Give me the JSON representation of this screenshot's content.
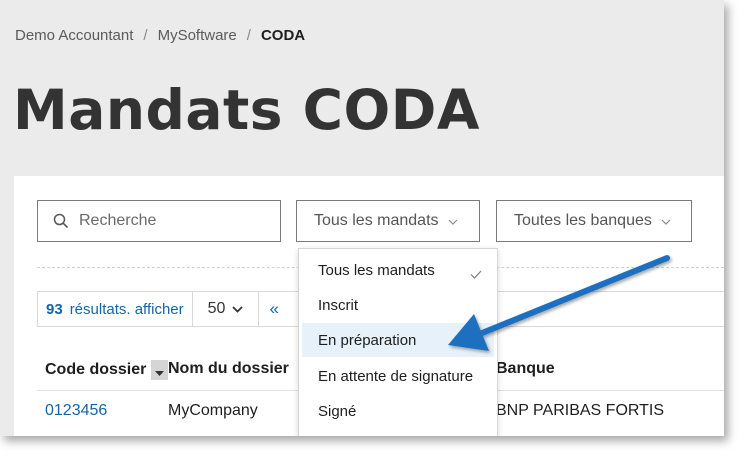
{
  "breadcrumb": {
    "items": [
      "Demo Accountant",
      "MySoftware"
    ],
    "current": "CODA",
    "separator": "/"
  },
  "page": {
    "title": "Mandats CODA"
  },
  "search": {
    "placeholder": "Recherche",
    "icon": "search-icon"
  },
  "filters": {
    "mandates": {
      "label": "Tous les mandats",
      "icon": "chevron-down-icon"
    },
    "banks": {
      "label": "Toutes les banques",
      "icon": "chevron-down-icon"
    }
  },
  "pager": {
    "count": "93",
    "results_text": "résultats. afficher",
    "page_size": "50",
    "first_glyph": "«"
  },
  "table": {
    "columns": {
      "code": "Code dossier",
      "name": "Nom du dossier",
      "bank": "Banque"
    },
    "rows": [
      {
        "code": "0123456",
        "name": "MyCompany",
        "bank": "BNP PARIBAS FORTIS"
      }
    ]
  },
  "dropdown": {
    "options": [
      {
        "label": "Tous les mandats",
        "selected": true
      },
      {
        "label": "Inscrit"
      },
      {
        "label": "En préparation",
        "highlighted": true
      },
      {
        "label": "En attente de signature"
      },
      {
        "label": "Signé"
      }
    ]
  },
  "colors": {
    "link": "#1565a6",
    "arrow": "#1f6fbf",
    "highlight": "#e6f1fa",
    "header_bg": "#ebebeb"
  }
}
